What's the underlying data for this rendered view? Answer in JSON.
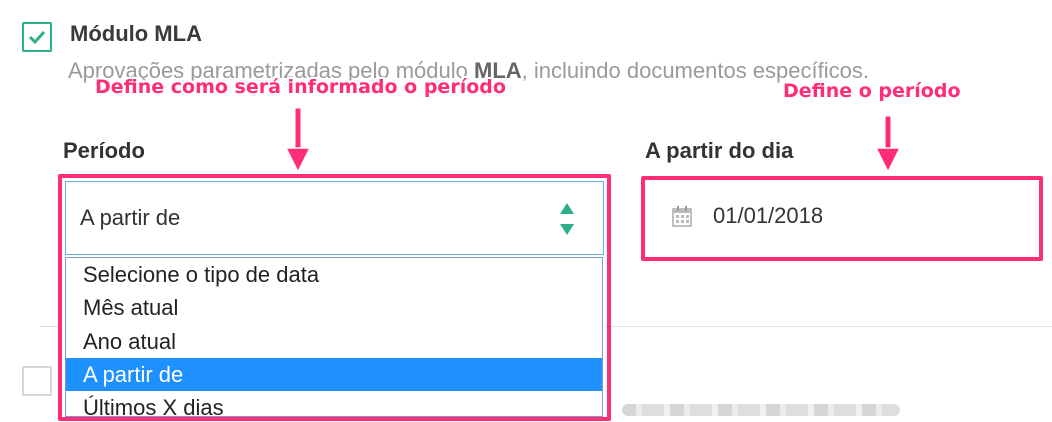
{
  "module": {
    "checked": true,
    "title": "Módulo MLA",
    "desc_prefix": "Aprovações parametrizadas pelo módulo ",
    "desc_bold": "MLA",
    "desc_suffix": ", incluindo documentos específicos."
  },
  "annotations": {
    "left": "Define como será informado o período",
    "right": "Define o período",
    "color": "#ff2d78"
  },
  "period_field": {
    "label": "Período",
    "selected_value": "A partir de",
    "options": [
      {
        "label": "Selecione o tipo de data",
        "selected": false
      },
      {
        "label": "Mês atual",
        "selected": false
      },
      {
        "label": "Ano atual",
        "selected": false
      },
      {
        "label": "A partir de",
        "selected": true
      },
      {
        "label": "Últimos X dias",
        "selected": false
      }
    ]
  },
  "date_field": {
    "label": "A partir do dia",
    "value": "01/01/2018",
    "icon": "calendar-icon"
  },
  "colors": {
    "accent": "#2bb08a",
    "selection": "#1e90ff",
    "highlight": "#ff2d78"
  }
}
